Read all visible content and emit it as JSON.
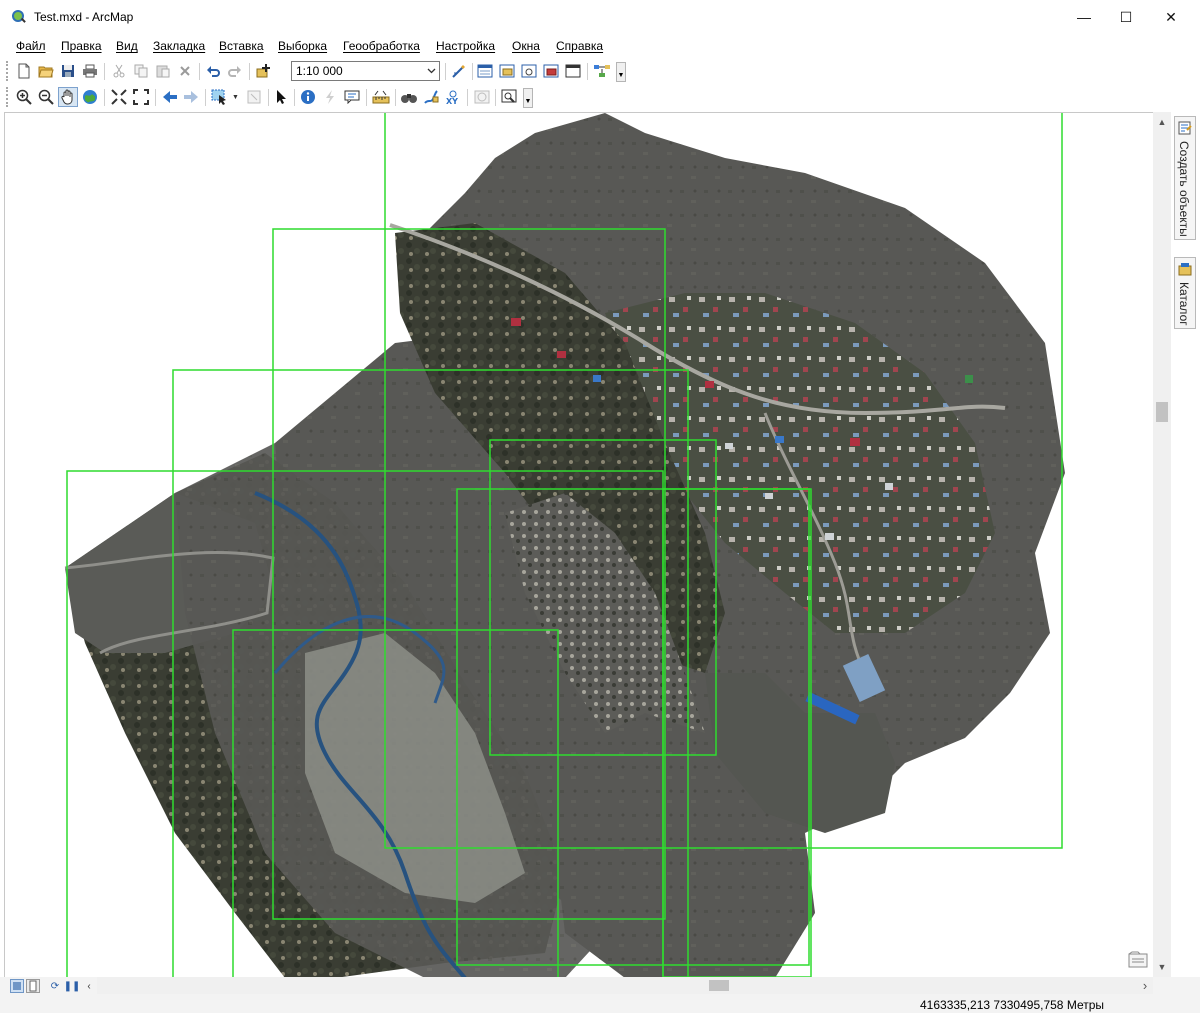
{
  "window": {
    "title": "Test.mxd - ArcMap",
    "minimize_glyph": "—",
    "maximize_glyph": "☐",
    "close_glyph": "✕"
  },
  "menu": {
    "items": [
      {
        "label": "Файл"
      },
      {
        "label": "Правка"
      },
      {
        "label": "Вид"
      },
      {
        "label": "Закладка"
      },
      {
        "label": "Вставка"
      },
      {
        "label": "Выборка"
      },
      {
        "label": "Геообработка"
      },
      {
        "label": "Настройка"
      },
      {
        "label": "Окна"
      },
      {
        "label": "Справка"
      }
    ]
  },
  "toolbar": {
    "scale": "1:10 000",
    "standard_icons": [
      "new-document-icon",
      "open-icon",
      "save-icon",
      "print-icon",
      "cut-icon",
      "copy-icon",
      "paste-icon",
      "delete-icon",
      "undo-icon",
      "redo-icon",
      "add-data-icon",
      "editor-toolbar-icon",
      "table-of-contents-icon",
      "catalog-window-icon",
      "search-window-icon",
      "arctoolbox-icon",
      "python-window-icon",
      "model-builder-icon"
    ],
    "tools_icons": [
      "zoom-in-icon",
      "zoom-out-icon",
      "pan-icon",
      "full-extent-icon",
      "fixed-zoom-in-icon",
      "fixed-zoom-out-icon",
      "back-extent-icon",
      "forward-extent-icon",
      "select-features-icon",
      "clear-selection-icon",
      "select-elements-icon",
      "identify-icon",
      "hyperlink-icon",
      "html-popup-icon",
      "measure-icon",
      "find-icon",
      "find-route-icon",
      "go-to-xy-icon",
      "time-slider-icon",
      "viewer-window-icon"
    ]
  },
  "side_panel": {
    "tabs": [
      {
        "label": "Создать объекты",
        "icon": "create-features-icon"
      },
      {
        "label": "Каталог",
        "icon": "catalog-icon"
      }
    ]
  },
  "status": {
    "coordinates": "4163335,213  7330495,758 Метры"
  },
  "map": {
    "layer_types": [
      "orthophoto-tiles",
      "tile-footprints"
    ],
    "footprint_color": "#2fdc2f",
    "accent_colors": {
      "vegetation": "#3e4a30",
      "soil": "#6b6258",
      "water": "#2f5a8a",
      "roof_red": "#b03040",
      "roof_blue": "#3a78c8"
    }
  }
}
